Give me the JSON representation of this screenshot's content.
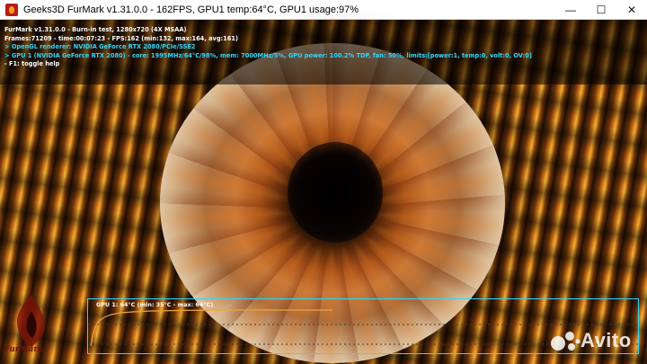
{
  "window": {
    "title": "Geeks3D FurMark v1.31.0.0 - 162FPS, GPU1 temp:64°C, GPU1 usage:97%",
    "controls": {
      "minimize": "—",
      "maximize": "☐",
      "close": "✕"
    }
  },
  "hud": {
    "line1": "FurMark v1.31.0.0 - Burn-in test, 1280x720 (4X MSAA)",
    "line2": "Frames:71209 - time:00:07:23 - FPS:162 (min:132, max:164, avg:161)",
    "line3": "> OpenGL renderer: NVIDIA GeForce RTX 2080/PCIe/SSE2",
    "line4": "> GPU 1 (NVIDIA GeForce RTX 2080) - core: 1995MHz/64°C/98%, mem: 7000MHz/5%, GPU power: 100.2% TDP, fan: 50%, limits:[power:1, temp:0, volt:0, OV:0]",
    "line5": "- F1: toggle help"
  },
  "graph": {
    "label": "GPU 1: 64°C (min: 35°C - max: 64°C)"
  },
  "logo": {
    "text": "FurMark"
  },
  "watermark": {
    "text": "Avito"
  },
  "colors": {
    "hud_cyan": "#2fd8ff",
    "graph_line": "#f2a23a",
    "graph_border": "#2fd8ff"
  }
}
